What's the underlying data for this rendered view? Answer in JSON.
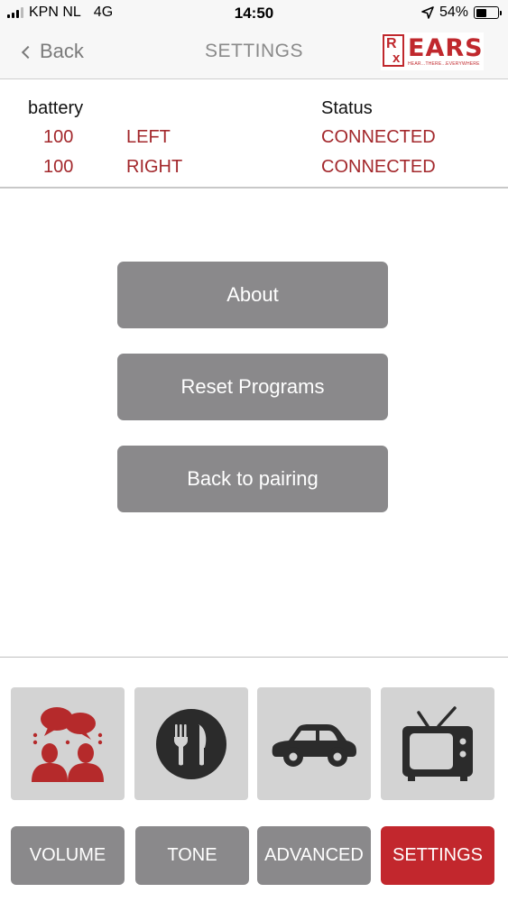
{
  "status_bar": {
    "carrier": "KPN NL",
    "network": "4G",
    "time": "14:50",
    "battery_percent": "54%",
    "battery_level": 0.54
  },
  "nav": {
    "back_label": "Back",
    "title": "SETTINGS",
    "logo": {
      "rx_r": "R",
      "rx_x": "x",
      "word": "EARS",
      "tagline": "HEAR...THERE...EVERYWHERE"
    }
  },
  "devices": {
    "battery_header": "battery",
    "status_header": "Status",
    "rows": [
      {
        "level": "100",
        "side": "LEFT",
        "status": "CONNECTED"
      },
      {
        "level": "100",
        "side": "RIGHT",
        "status": "CONNECTED"
      }
    ]
  },
  "menu": {
    "about": "About",
    "reset": "Reset Programs",
    "pairing": "Back to pairing"
  },
  "programs": [
    {
      "icon": "conversation-icon"
    },
    {
      "icon": "restaurant-icon"
    },
    {
      "icon": "car-icon"
    },
    {
      "icon": "tv-icon"
    }
  ],
  "tabs": {
    "volume": "VOLUME",
    "tone": "TONE",
    "advanced": "ADVANCED",
    "settings": "SETTINGS",
    "active": "settings"
  },
  "colors": {
    "accent_red": "#c2272d",
    "status_red": "#a3282c",
    "button_gray": "#8a898b",
    "tile_gray": "#d3d3d3"
  }
}
